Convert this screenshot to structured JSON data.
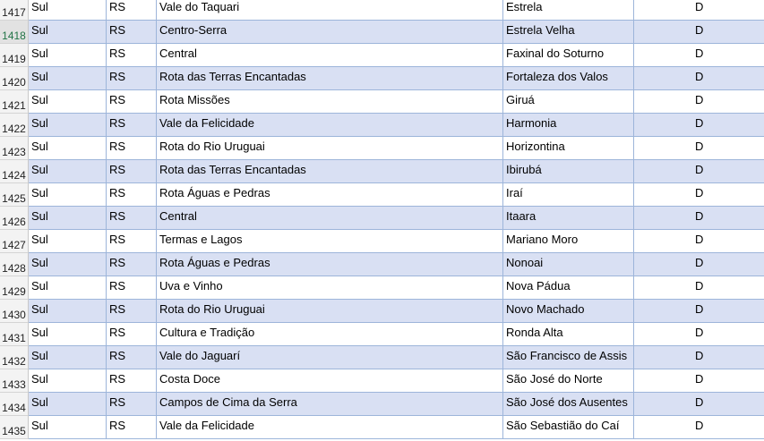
{
  "sheet": {
    "selected_row": "1418",
    "rows": [
      {
        "num": "1417",
        "region": "Sul",
        "uf": "RS",
        "route": "Vale do Taquari",
        "city": "Estrela",
        "cat": "D"
      },
      {
        "num": "1418",
        "region": "Sul",
        "uf": "RS",
        "route": "Centro-Serra",
        "city": "Estrela Velha",
        "cat": "D"
      },
      {
        "num": "1419",
        "region": "Sul",
        "uf": "RS",
        "route": "Central",
        "city": "Faxinal do Soturno",
        "cat": "D"
      },
      {
        "num": "1420",
        "region": "Sul",
        "uf": "RS",
        "route": "Rota das Terras Encantadas",
        "city": "Fortaleza dos Valos",
        "cat": "D"
      },
      {
        "num": "1421",
        "region": "Sul",
        "uf": "RS",
        "route": "Rota Missões",
        "city": "Giruá",
        "cat": "D"
      },
      {
        "num": "1422",
        "region": "Sul",
        "uf": "RS",
        "route": "Vale da Felicidade",
        "city": "Harmonia",
        "cat": "D"
      },
      {
        "num": "1423",
        "region": "Sul",
        "uf": "RS",
        "route": "Rota do Rio Uruguai",
        "city": "Horizontina",
        "cat": "D"
      },
      {
        "num": "1424",
        "region": "Sul",
        "uf": "RS",
        "route": "Rota das Terras Encantadas",
        "city": "Ibirubá",
        "cat": "D"
      },
      {
        "num": "1425",
        "region": "Sul",
        "uf": "RS",
        "route": "Rota Águas e Pedras",
        "city": "Iraí",
        "cat": "D"
      },
      {
        "num": "1426",
        "region": "Sul",
        "uf": "RS",
        "route": "Central",
        "city": "Itaara",
        "cat": "D"
      },
      {
        "num": "1427",
        "region": "Sul",
        "uf": "RS",
        "route": "Termas e Lagos",
        "city": "Mariano Moro",
        "cat": "D"
      },
      {
        "num": "1428",
        "region": "Sul",
        "uf": "RS",
        "route": "Rota Águas e Pedras",
        "city": "Nonoai",
        "cat": "D"
      },
      {
        "num": "1429",
        "region": "Sul",
        "uf": "RS",
        "route": "Uva e Vinho",
        "city": "Nova Pádua",
        "cat": "D"
      },
      {
        "num": "1430",
        "region": "Sul",
        "uf": "RS",
        "route": "Rota do Rio Uruguai",
        "city": "Novo Machado",
        "cat": "D"
      },
      {
        "num": "1431",
        "region": "Sul",
        "uf": "RS",
        "route": "Cultura e Tradição",
        "city": "Ronda Alta",
        "cat": "D"
      },
      {
        "num": "1432",
        "region": "Sul",
        "uf": "RS",
        "route": "Vale do Jaguarí",
        "city": "São Francisco de Assis",
        "cat": "D"
      },
      {
        "num": "1433",
        "region": "Sul",
        "uf": "RS",
        "route": "Costa Doce",
        "city": "São José do Norte",
        "cat": "D"
      },
      {
        "num": "1434",
        "region": "Sul",
        "uf": "RS",
        "route": "Campos de Cima da Serra",
        "city": "São José dos Ausentes",
        "cat": "D"
      },
      {
        "num": "1435",
        "region": "Sul",
        "uf": "RS",
        "route": "Vale da Felicidade",
        "city": "São Sebastião do Caí",
        "cat": "D"
      }
    ]
  }
}
